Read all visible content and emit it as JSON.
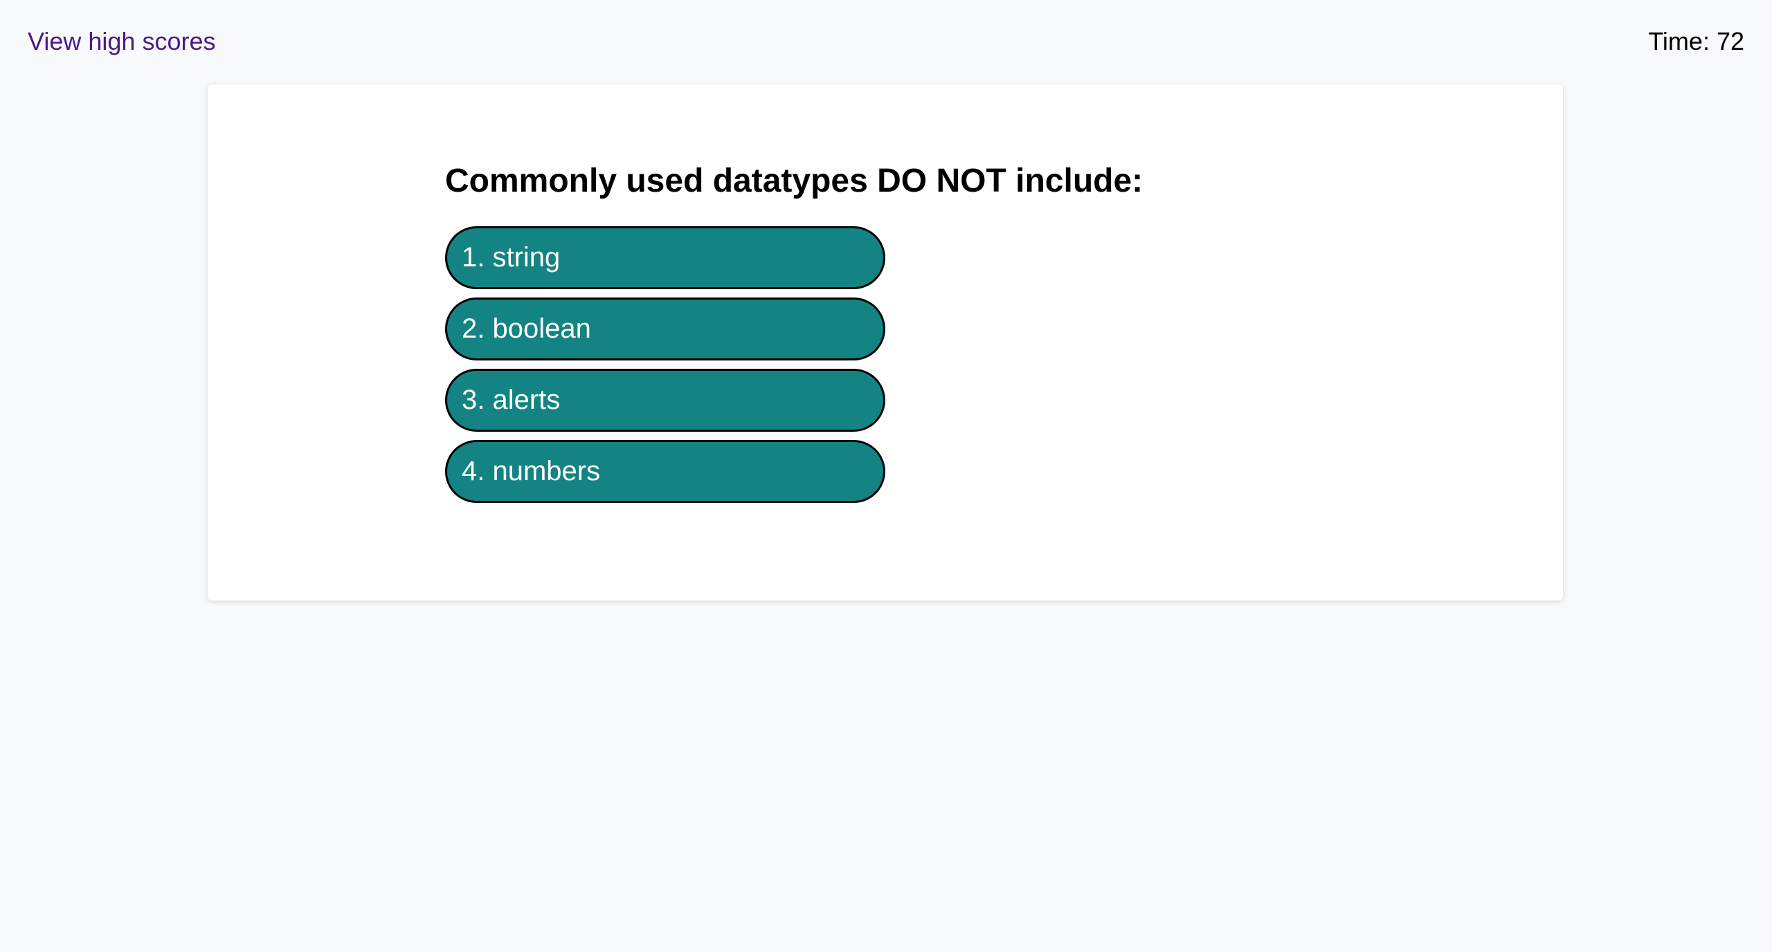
{
  "header": {
    "high_scores_link": "View high scores",
    "timer_label": "Time:",
    "timer_value": "72"
  },
  "quiz": {
    "question": "Commonly used datatypes DO NOT include:",
    "choices": [
      {
        "label": "1. string"
      },
      {
        "label": "2. boolean"
      },
      {
        "label": "3. alerts"
      },
      {
        "label": "4. numbers"
      }
    ]
  },
  "colors": {
    "choice_background": "#138383",
    "link": "#4b1a86",
    "page_background": "#f8f9fb"
  }
}
